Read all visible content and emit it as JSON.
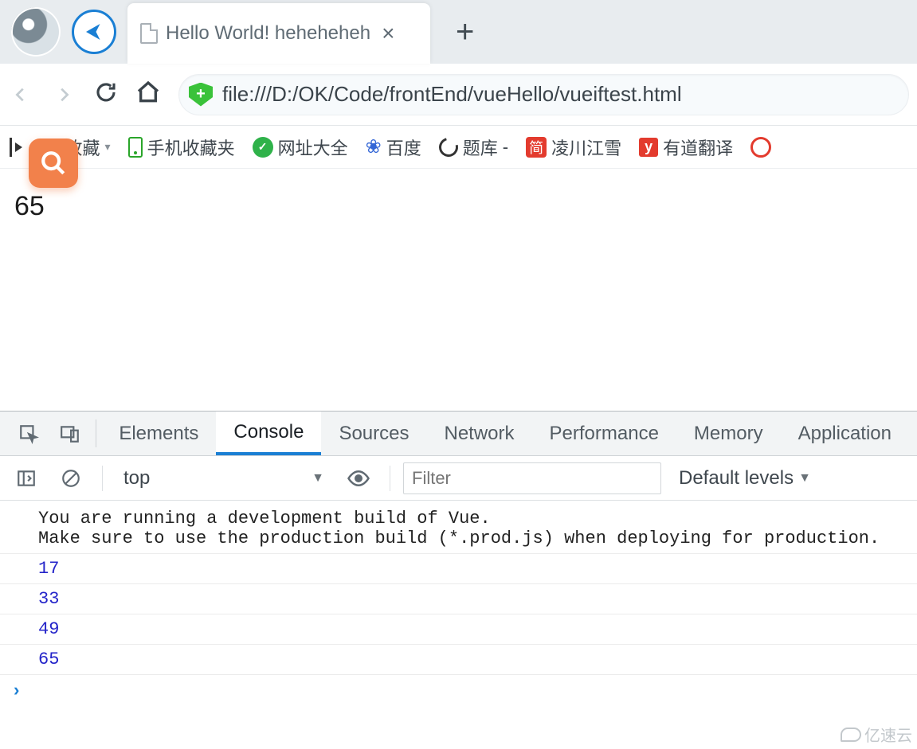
{
  "browser": {
    "tab_title": "Hello World! heheheheh",
    "url": "file:///D:/OK/Code/frontEnd/vueHello/vueiftest.html",
    "new_tab_glyph": "+",
    "close_glyph": "×",
    "shield_glyph": "+"
  },
  "bookmarks": {
    "favorites_label": "收藏",
    "mobile_label": "手机收藏夹",
    "site_list_label": "网址大全",
    "baidu_label": "百度",
    "tiku_label": "题库",
    "lingchuan_label": "凌川江雪",
    "youdao_label": "有道翻译",
    "jian_glyph": "简",
    "y_glyph": "y",
    "baidu_glyph": "❀",
    "c360_glyph": "✓",
    "tiku_sep": "-",
    "drop_glyph": "▾"
  },
  "page_content": {
    "value": "65"
  },
  "devtools": {
    "tabs": {
      "elements": "Elements",
      "console": "Console",
      "sources": "Sources",
      "network": "Network",
      "performance": "Performance",
      "memory": "Memory",
      "application": "Application"
    },
    "active_tab": "console",
    "toolbar": {
      "context": "top",
      "context_arrow": "▼",
      "filter_placeholder": "Filter",
      "levels_label": "Default levels",
      "levels_arrow": "▼"
    },
    "logs": [
      {
        "type": "text",
        "text": "You are running a development build of Vue.\nMake sure to use the production build (*.prod.js) when deploying for production."
      },
      {
        "type": "num",
        "text": "17"
      },
      {
        "type": "num",
        "text": "33"
      },
      {
        "type": "num",
        "text": "49"
      },
      {
        "type": "num",
        "text": "65"
      }
    ],
    "prompt_glyph": "›"
  },
  "watermark": "亿速云"
}
